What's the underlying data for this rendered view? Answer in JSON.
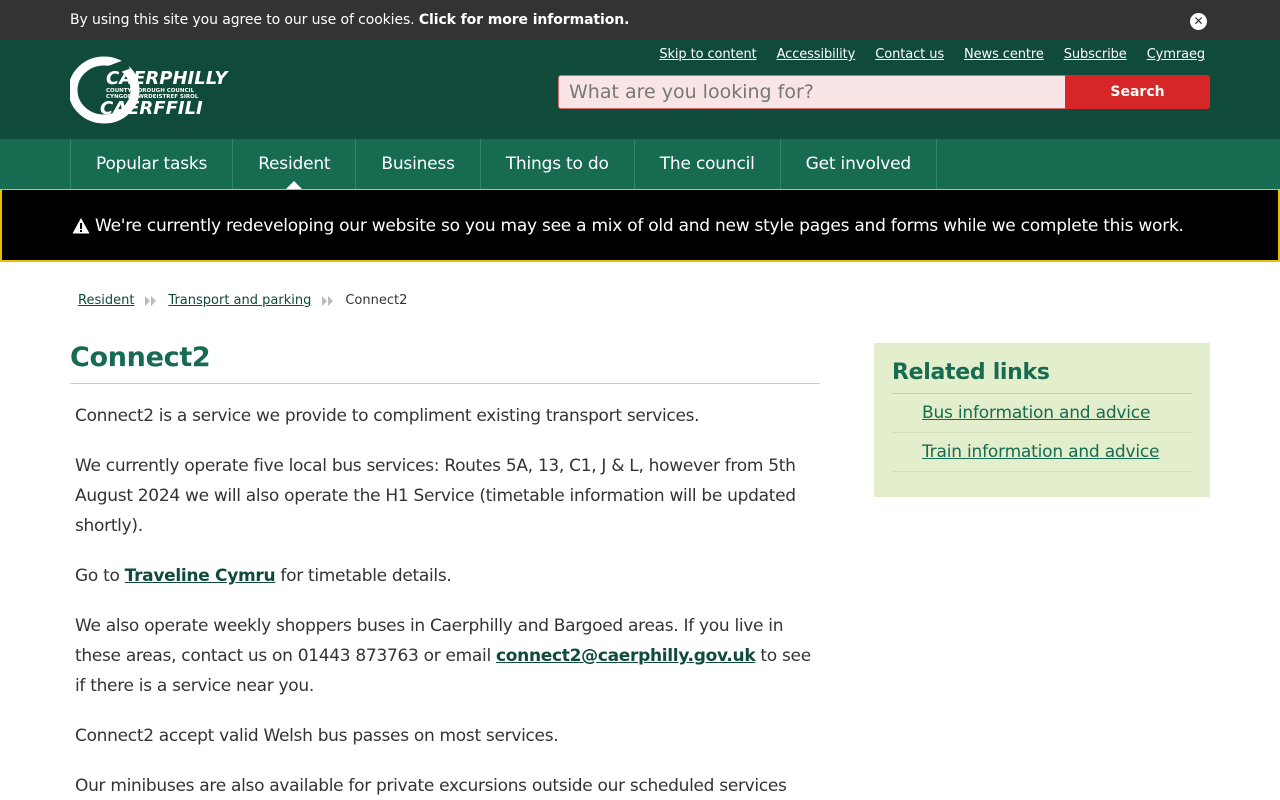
{
  "cookie": {
    "text": "By using this site you agree to our use of cookies.",
    "link": "Click for more information.",
    "close_glyph": "✕"
  },
  "logo": {
    "alt_lines": [
      "CAERPHILLY",
      "COUNTY BOROUGH COUNCIL",
      "CYNGOR BWRDEISTREF SIROL",
      "CAERFFILI"
    ]
  },
  "utility": {
    "links": [
      "Skip to content",
      "Accessibility",
      "Contact us",
      "News centre",
      "Subscribe",
      "Cymraeg"
    ]
  },
  "search": {
    "placeholder": "What are you looking for?",
    "button": "Search"
  },
  "nav": {
    "items": [
      "Popular tasks",
      "Resident",
      "Business",
      "Things to do",
      "The council",
      "Get involved"
    ],
    "active": "Resident"
  },
  "alert": {
    "icon": "warning-icon",
    "text": "We're currently redeveloping our website so you may see a mix of old and new style pages and forms while we complete this work."
  },
  "breadcrumb": {
    "items": [
      "Resident",
      "Transport and parking"
    ],
    "current": "Connect2"
  },
  "page": {
    "title": "Connect2",
    "p1": "Connect2 is a service we provide to compliment existing transport services.",
    "p2": "We currently operate five local bus services: Routes 5A, 13, C1, J & L, however from 5th August 2024 we will also operate the H1 Service (timetable information will be updated shortly).",
    "p3_before": "Go to ",
    "p3_link": "Traveline Cymru",
    "p3_after": " for timetable details.",
    "p4_before": "We also operate weekly shoppers buses in Caerphilly and Bargoed areas. If you live in these areas, contact us on 01443 873763 or email ",
    "p4_link": "connect2@caerphilly.gov.uk",
    "p4_after": " to see if there is a service near you.",
    "p5": "Connect2 accept valid Welsh bus passes on most services.",
    "p6": "Our minibuses are also available for private excursions outside our scheduled services"
  },
  "sidebar": {
    "title": "Related links",
    "links": [
      "Bus information and advice",
      "Train information and advice"
    ]
  },
  "colors": {
    "header": "#0f4a3a",
    "nav": "#166b51",
    "search_button": "#d62627",
    "sidebar_bg": "#e3eecd",
    "alert_border": "#e6c200"
  }
}
